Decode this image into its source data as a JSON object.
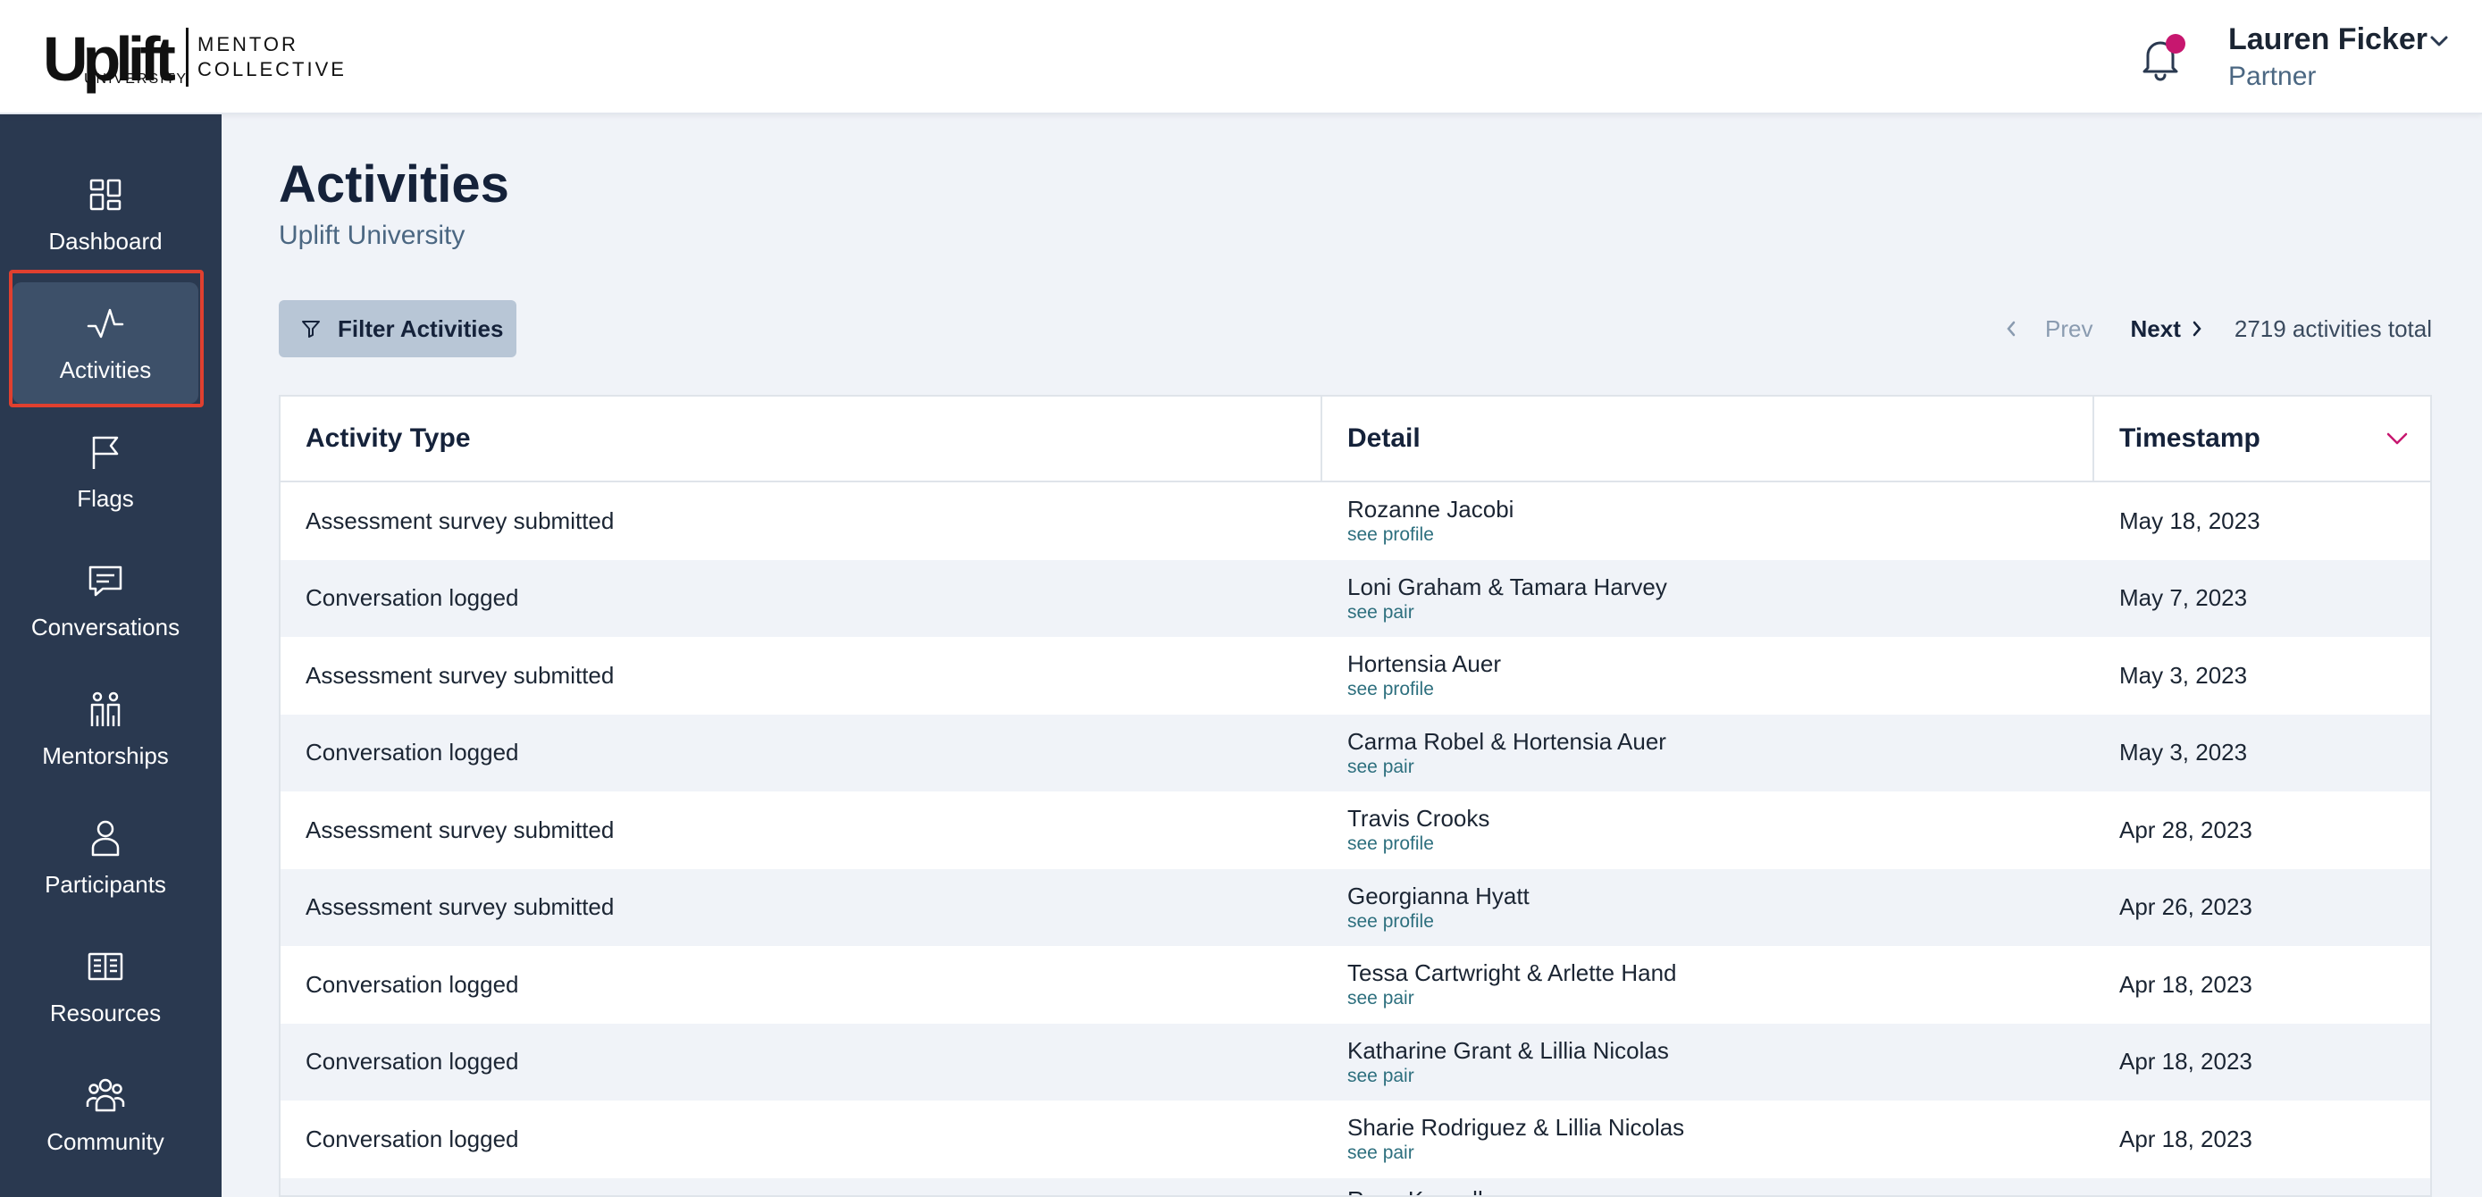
{
  "brand": {
    "logo_word": "Uplift",
    "logo_sub": "UNIVERSITY",
    "partner_line1": "MENTOR",
    "partner_line2": "COLLECTIVE"
  },
  "user": {
    "name": "Lauren Ficker",
    "role": "Partner"
  },
  "colors": {
    "sidebar_bg": "#2a3950",
    "active_item_bg": "#3d5069",
    "notification_dot": "#c7176f",
    "highlight_outline": "#e0402f",
    "link": "#2d6f7e",
    "filter_button_bg": "#b8c6d6"
  },
  "sidebar": {
    "items": [
      {
        "label": "Dashboard",
        "icon": "dashboard-icon",
        "active": false
      },
      {
        "label": "Activities",
        "icon": "activity-pulse-icon",
        "active": true
      },
      {
        "label": "Flags",
        "icon": "flag-icon",
        "active": false
      },
      {
        "label": "Conversations",
        "icon": "chat-bubble-icon",
        "active": false
      },
      {
        "label": "Mentorships",
        "icon": "pair-people-icon",
        "active": false
      },
      {
        "label": "Participants",
        "icon": "person-icon",
        "active": false
      },
      {
        "label": "Resources",
        "icon": "book-icon",
        "active": false
      },
      {
        "label": "Community",
        "icon": "group-icon",
        "active": false
      }
    ]
  },
  "page": {
    "title": "Activities",
    "subtitle": "Uplift University"
  },
  "toolbar": {
    "filter_label": "Filter Activities",
    "prev_label": "Prev",
    "next_label": "Next",
    "total_label": "2719 activities total"
  },
  "table": {
    "headers": [
      "Activity Type",
      "Detail",
      "Timestamp"
    ],
    "rows": [
      {
        "type": "Assessment survey submitted",
        "detail": "Rozanne Jacobi",
        "link": "see profile",
        "timestamp": "May 18, 2023"
      },
      {
        "type": "Conversation logged",
        "detail": "Loni Graham & Tamara Harvey",
        "link": "see pair",
        "timestamp": "May 7, 2023"
      },
      {
        "type": "Assessment survey submitted",
        "detail": "Hortensia Auer",
        "link": "see profile",
        "timestamp": "May 3, 2023"
      },
      {
        "type": "Conversation logged",
        "detail": "Carma Robel & Hortensia Auer",
        "link": "see pair",
        "timestamp": "May 3, 2023"
      },
      {
        "type": "Assessment survey submitted",
        "detail": "Travis Crooks",
        "link": "see profile",
        "timestamp": "Apr 28, 2023"
      },
      {
        "type": "Assessment survey submitted",
        "detail": "Georgianna Hyatt",
        "link": "see profile",
        "timestamp": "Apr 26, 2023"
      },
      {
        "type": "Conversation logged",
        "detail": "Tessa Cartwright & Arlette Hand",
        "link": "see pair",
        "timestamp": "Apr 18, 2023"
      },
      {
        "type": "Conversation logged",
        "detail": "Katharine Grant & Lillia Nicolas",
        "link": "see pair",
        "timestamp": "Apr 18, 2023"
      },
      {
        "type": "Conversation logged",
        "detail": "Sharie Rodriguez & Lillia Nicolas",
        "link": "see pair",
        "timestamp": "Apr 18, 2023"
      },
      {
        "type": "",
        "detail": "Rosa Kassulke",
        "link": "",
        "timestamp": ""
      }
    ]
  }
}
